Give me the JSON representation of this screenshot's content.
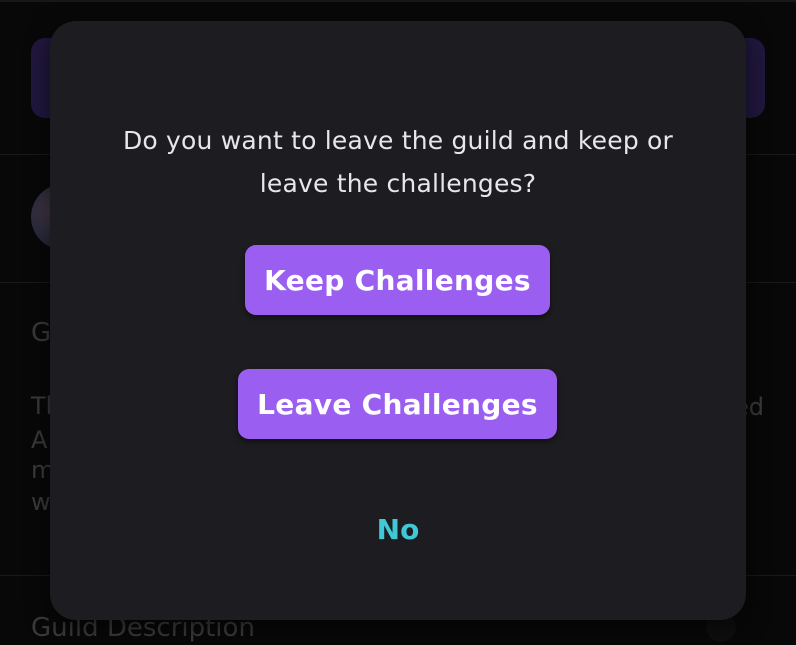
{
  "dialog": {
    "message": "Do you want to leave the guild and keep or leave the challenges?",
    "keep_label": "Keep Challenges",
    "leave_label": "Leave Challenges",
    "no_label": "No"
  },
  "background": {
    "section_title_fragment": "G",
    "paragraph_fragments_left": [
      "Th",
      "A",
      "m",
      "w"
    ],
    "paragraph_fragment_right": "ed",
    "bottom_title": "Guild Description"
  },
  "colors": {
    "dialog_bg": "#1d1c20",
    "primary_button": "#9a5ff0",
    "text_button": "#3fc8d6",
    "header_bar": "#3d2a73"
  }
}
